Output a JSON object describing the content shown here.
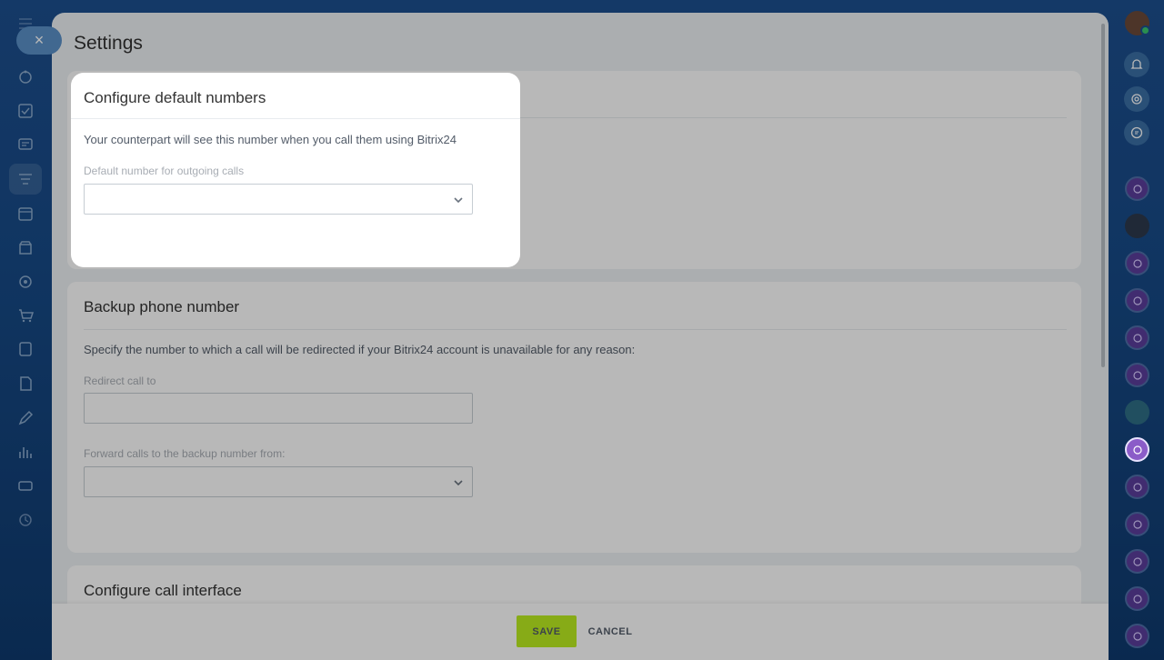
{
  "app": {
    "page_title": "Settings"
  },
  "left_rail": {
    "close_label": "×",
    "items": [
      "crm-icon",
      "tasks-icon",
      "chat-icon",
      "filter-icon",
      "calendar-icon",
      "store-icon",
      "target-icon",
      "cart-icon",
      "document-icon",
      "edit-doc-icon",
      "pen-icon",
      "analytics-icon",
      "inbox-icon",
      "clock-icon"
    ]
  },
  "right_rail": {
    "items": [
      "bell-icon",
      "copilot-icon",
      "support-icon"
    ]
  },
  "highlight_card": {
    "title": "Configure default numbers",
    "description": "Your counterpart will see this number when you call them using Bitrix24",
    "field_label": "Default number for outgoing calls",
    "field_value": ""
  },
  "backup_card": {
    "title": "Backup phone number",
    "description": "Specify the number to which a call will be redirected if your Bitrix24 account is unavailable for any reason:",
    "redirect_label": "Redirect call to",
    "redirect_value": "",
    "forward_label": "Forward calls to the backup number from:",
    "forward_value": ""
  },
  "interface_card": {
    "title": "Configure call interface"
  },
  "footer": {
    "save_label": "SAVE",
    "cancel_label": "CANCEL"
  },
  "colors": {
    "save_button": "#bbed21",
    "accent": "#2fc6f6",
    "background": "#1d4f8f"
  }
}
